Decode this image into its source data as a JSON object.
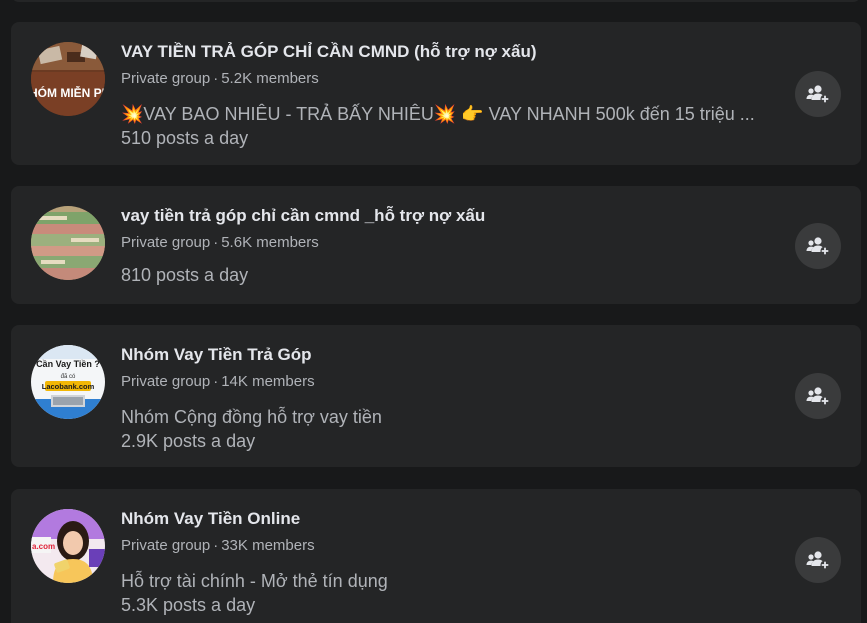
{
  "groups": [
    {
      "name": "VAY TIỀN TRẢ GÓP CHỈ CẦN CMND (hỗ trợ nợ xấu)",
      "privacy": "Private group",
      "separator": "·",
      "members": "5.2K members",
      "description": "💥VAY BAO NHIÊU - TRẢ BẤY NHIÊU💥  👉  VAY NHANH 500k đến 15 triệu ...",
      "posts": "510 posts a day",
      "avatar_icon": "group-photo-nhom-mien-phi",
      "avatar_text": "HÓM MIỄN PH"
    },
    {
      "name": "vay tiền trả góp chỉ cần cmnd _hỗ trợ nợ xấu",
      "privacy": "Private group",
      "separator": "·",
      "members": "5.6K members",
      "description": "",
      "posts": "810 posts a day",
      "avatar_icon": "group-photo-money"
    },
    {
      "name": "Nhóm Vay Tiền Trả Góp",
      "privacy": "Private group",
      "separator": "·",
      "members": "14K members",
      "description": "Nhóm Cộng đồng hỗ trợ vay tiền",
      "posts": "2.9K posts a day",
      "avatar_icon": "group-photo-lacobank",
      "avatar_text_top": "Cần Vay Tiền ?",
      "avatar_text_mid": "đã có",
      "avatar_text_brand": "Lacobank.com"
    },
    {
      "name": "Nhóm Vay Tiền Online",
      "privacy": "Private group",
      "separator": "·",
      "members": "33K members",
      "description": "Hỗ trợ tài chính - Mở thẻ tín dụng",
      "posts": "5.3K posts a day",
      "avatar_icon": "group-photo-woman",
      "avatar_text": "a.com"
    }
  ],
  "join_button_icon": "join-group-icon",
  "colors": {
    "background": "#18191a",
    "card": "#242526",
    "primary_text": "#e4e6eb",
    "secondary_text": "#b0b3b8",
    "button": "#3a3b3c"
  }
}
